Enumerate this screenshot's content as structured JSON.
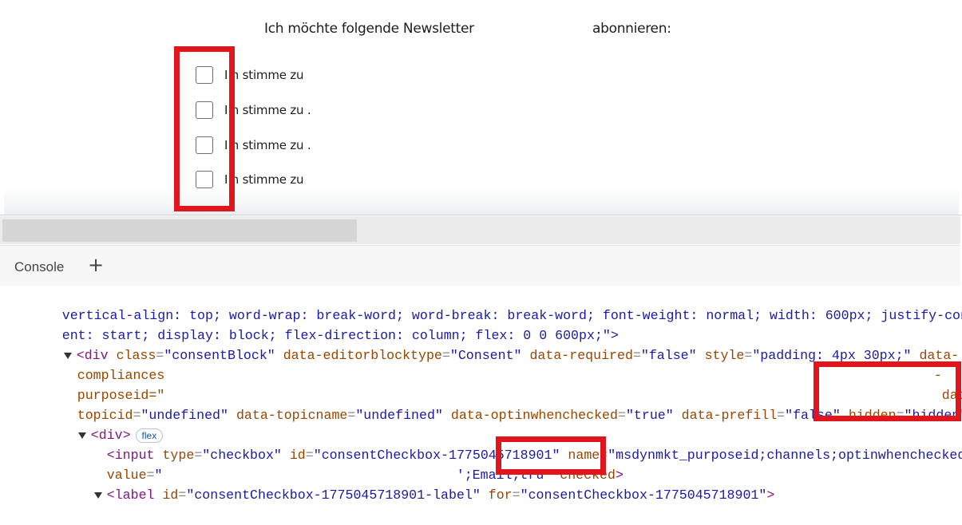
{
  "page": {
    "heading": "Ich möchte folgende Newsletter",
    "heading_right": "abonnieren:",
    "checkbox_labels": [
      "I h stimme zu",
      "I h stimme zu .",
      "I h stimme zu .",
      "I h stimme zu"
    ]
  },
  "devtools": {
    "tab_console": "Console",
    "add_tab": "+",
    "lines": {
      "l1": "vertical-align: top; word-wrap: break-word; word-break: break-word; font-weight: normal; width: 600px; justify-cont",
      "l2": "ent: start; display: block; flex-direction: column; flex: 0 0 600px;\">",
      "l3_tag": "<div",
      "l3_a1": "class",
      "l3_v1": "\"consentBlock\"",
      "l3_a2": "data-editorblocktype",
      "l3_v2": "\"Consent\"",
      "l3_a3": "data-required",
      "l3_v3": "\"false\"",
      "l3_a4": "style",
      "l3_v4": "\"padding: 4px 30px;\"",
      "l3_a5": "data-",
      "l4": "compliances",
      "l4_dash": "-",
      "l5": "purposeid=\"",
      "l5_right": "data-",
      "l6_a1": "topicid",
      "l6_v1": "\"undefined\"",
      "l6_a2": "data-topicname",
      "l6_v2": "\"undefined\"",
      "l6_a3": "data-optinwhenchecked",
      "l6_v3": "\"true\"",
      "l6_a4": "data-prefill",
      "l6_v4": "\"false\"",
      "l6_a5": "hidden",
      "l6_v5": "\"hidden\"",
      "l6_end": ">",
      "l7_tag": "<div>",
      "l7_badge": "flex",
      "l8_tag": "<input",
      "l8_a1": "type",
      "l8_v1": "\"checkbox\"",
      "l8_a2": "id",
      "l8_v2": "\"consentCheckbox-1775045718901\"",
      "l8_a3": "name",
      "l8_v3": "\"msdynmkt_purposeid;channels;optinwhenchecked\"",
      "l9_a1": "value",
      "l9_v1": "\"",
      "l9_v1b": "';Email;tru",
      "l9_v1c": "\"",
      "l9_a2": "checked",
      "l9_end": ">",
      "l10_tag": "<label",
      "l10_a1": "id",
      "l10_v1": "\"consentCheckbox-1775045718901-label\"",
      "l10_a2": "for",
      "l10_v2": "\"consentCheckbox-1775045718901\"",
      "l10_end": ">"
    }
  }
}
